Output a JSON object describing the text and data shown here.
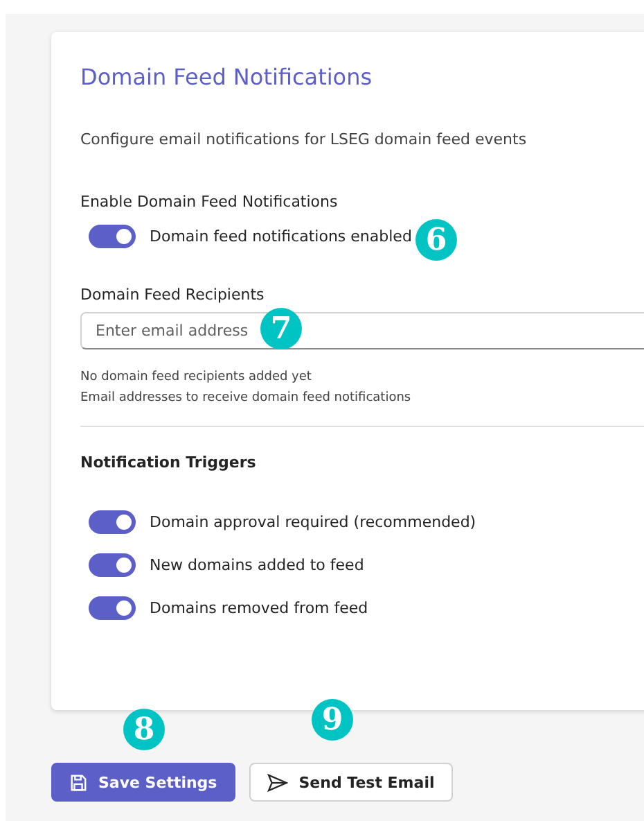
{
  "card": {
    "title": "Domain Feed Notifications",
    "description": "Configure email notifications for LSEG domain feed events",
    "enable": {
      "label": "Enable Domain Feed Notifications",
      "toggle": {
        "label": "Domain feed notifications enabled",
        "on": true
      }
    },
    "recipients": {
      "label": "Domain Feed Recipients",
      "placeholder": "Enter email address",
      "empty_note": "No domain feed recipients added yet",
      "hint": "Email addresses to receive domain feed notifications"
    },
    "triggers": {
      "heading": "Notification Triggers",
      "items": [
        {
          "label": "Domain approval required (recommended)",
          "on": true
        },
        {
          "label": "New domains added to feed",
          "on": true
        },
        {
          "label": "Domains removed from feed",
          "on": true
        }
      ]
    }
  },
  "buttons": [
    {
      "label": "Save Settings",
      "kind": "primary"
    },
    {
      "label": "Send Test Email",
      "kind": "secondary"
    }
  ],
  "callouts": [
    "6",
    "7",
    "8",
    "9"
  ]
}
